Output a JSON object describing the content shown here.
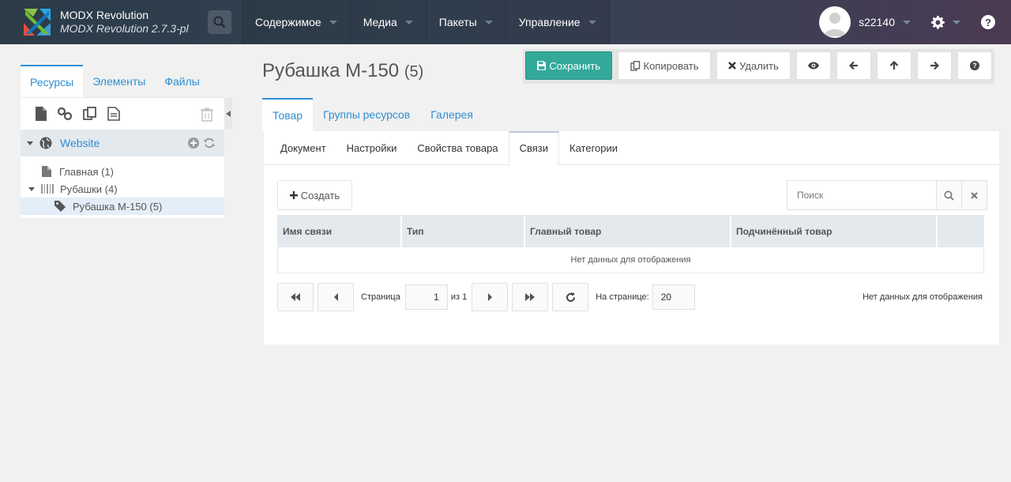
{
  "app": {
    "name": "MODX Revolution",
    "version": "MODX Revolution 2.7.3-pl"
  },
  "nav": {
    "items": [
      {
        "label": "Содержимое"
      },
      {
        "label": "Медиа"
      },
      {
        "label": "Пакеты"
      },
      {
        "label": "Управление"
      }
    ]
  },
  "user": {
    "name": "s22140"
  },
  "left": {
    "tabs": [
      {
        "label": "Ресурсы"
      },
      {
        "label": "Элементы"
      },
      {
        "label": "Файлы"
      }
    ],
    "tree": {
      "root": "Website",
      "nodes": [
        {
          "label": "Главная (1)"
        },
        {
          "label": "Рубашки (4)"
        },
        {
          "label": "Рубашка М-150 (5)"
        }
      ]
    }
  },
  "page": {
    "title": "Рубашка М-150",
    "id": "(5)"
  },
  "toolbar": {
    "save": "Сохранить",
    "copy": "Копировать",
    "delete": "Удалить"
  },
  "tabs_top": [
    {
      "label": "Товар"
    },
    {
      "label": "Группы ресурсов"
    },
    {
      "label": "Галерея"
    }
  ],
  "tabs_inner": [
    {
      "label": "Документ"
    },
    {
      "label": "Настройки"
    },
    {
      "label": "Свойства товара"
    },
    {
      "label": "Связи"
    },
    {
      "label": "Категории"
    }
  ],
  "links": {
    "create": "Создать",
    "search_placeholder": "Поиск",
    "columns": [
      "Имя связи",
      "Тип",
      "Главный товар",
      "Подчинённый товар"
    ],
    "empty": "Нет данных для отображения"
  },
  "pager": {
    "page_label": "Страница",
    "page": "1",
    "of": "из 1",
    "per_page_label": "На странице:",
    "per_page": "20",
    "info": "Нет данных для отображения"
  },
  "colors": {
    "accent": "#2e8fd4",
    "primary_button": "#33a99a"
  }
}
